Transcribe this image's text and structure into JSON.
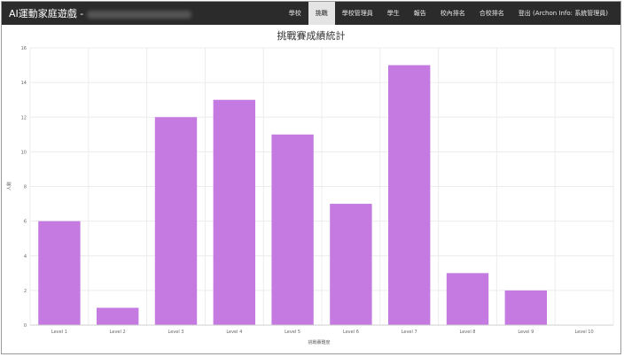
{
  "app": {
    "title": "AI運動家庭遊戲 -"
  },
  "nav": {
    "items": [
      {
        "label": "學校",
        "active": false
      },
      {
        "label": "挑戰",
        "active": true
      },
      {
        "label": "學校管理員",
        "active": false
      },
      {
        "label": "學生",
        "active": false
      },
      {
        "label": "報告",
        "active": false
      },
      {
        "label": "校內排名",
        "active": false
      },
      {
        "label": "合校排名",
        "active": false
      },
      {
        "label": "登出 (Archon Info: 系統管理員)",
        "active": false
      }
    ]
  },
  "colors": {
    "bar": "#c47ae0",
    "navbar": "#2b2b2b",
    "grid": "#ececec"
  },
  "chart_data": {
    "type": "bar",
    "title": "挑戰賽成績統計",
    "xlabel": "挑戰賽難度",
    "ylabel": "人數",
    "categories": [
      "Level 1",
      "Level 2",
      "Level 3",
      "Level 4",
      "Level 5",
      "Level 6",
      "Level 7",
      "Level 8",
      "Level 9",
      "Level 10"
    ],
    "values": [
      6,
      1,
      12,
      13,
      11,
      7,
      15,
      3,
      2,
      0
    ],
    "ylim": [
      0,
      16
    ],
    "yticks": [
      0,
      2,
      4,
      6,
      8,
      10,
      12,
      14,
      16
    ],
    "grid": true,
    "legend": "none"
  }
}
